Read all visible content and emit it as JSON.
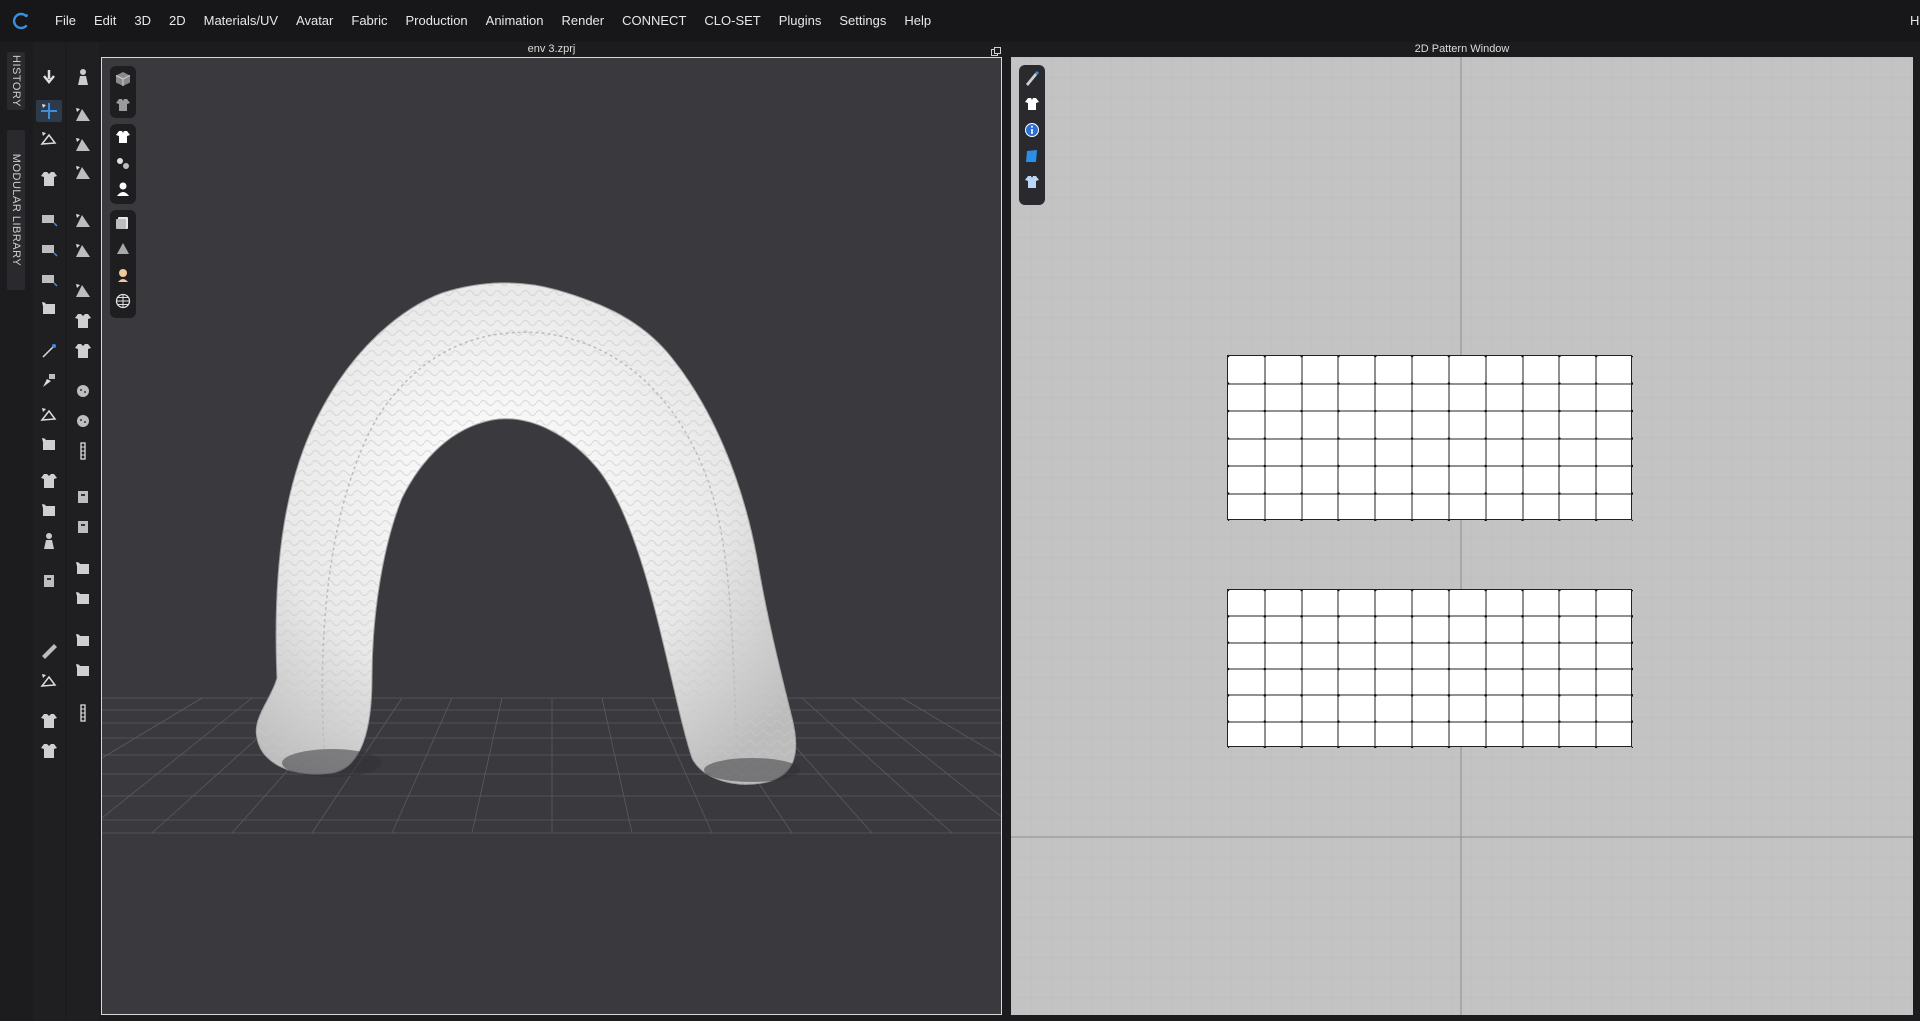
{
  "menu": [
    "File",
    "Edit",
    "3D",
    "2D",
    "Materials/UV",
    "Avatar",
    "Fabric",
    "Production",
    "Animation",
    "Render",
    "CONNECT",
    "CLO-SET",
    "Plugins",
    "Settings",
    "Help"
  ],
  "menu_right_truncated": "H",
  "side_tabs": {
    "history": "HISTORY",
    "modular_library": "MODULAR LIBRARY"
  },
  "viewport3d": {
    "title": "env 3.zprj"
  },
  "viewport2d": {
    "title": "2D Pattern Window"
  },
  "colors": {
    "accent": "#3b8fe0",
    "viewport_bg": "#3a3a3e",
    "pattern_bg": "#c3c3c3",
    "garment": "#e9e9e9"
  }
}
